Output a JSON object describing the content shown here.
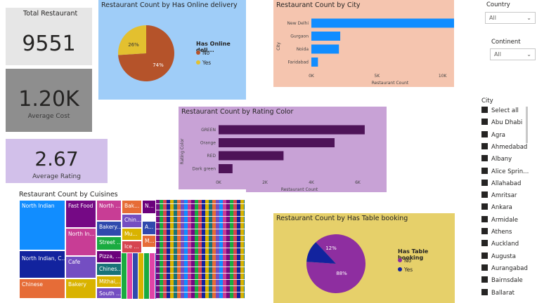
{
  "kpis": {
    "total_restaurant": {
      "label": "Total Restaurant",
      "value": "9551"
    },
    "average_cost": {
      "value": "1.20K",
      "label": "Average Cost"
    },
    "average_rating": {
      "value": "2.67",
      "label": "Average Rating"
    }
  },
  "online_delivery": {
    "title": "Restaurant Count by Has Online delivery",
    "legend_title": "Has Online deli...",
    "slices": [
      {
        "label": "No",
        "pct": "74%"
      },
      {
        "label": "Yes",
        "pct": "26%"
      }
    ]
  },
  "by_city": {
    "title": "Restaurant Count by City",
    "ylabel": "City",
    "xlabel": "Restaurant Count",
    "ticks": [
      "0K",
      "5K",
      "10K"
    ]
  },
  "rating_color": {
    "title": "Restaurant Count by Rating Color",
    "ylabel": "Rating Color",
    "xlabel": "Restaurant Count",
    "ticks": [
      "0K",
      "2K",
      "4K",
      "6K"
    ]
  },
  "cuisines": {
    "title": "Restaurant Count by Cuisines",
    "tiles": [
      "North Indian",
      "Fast Food",
      "North ...",
      "Bak...",
      "N...",
      "Chin...",
      "Bakery...",
      "A...",
      "North In...",
      "Mu...",
      "Street ...",
      "M...",
      "Ice ...",
      "North Indian, C...",
      "Cafe",
      "Chines...",
      "Pizza, ...",
      "Chinese",
      "Bakery",
      "Mithai,...",
      "South ..."
    ]
  },
  "table_booking": {
    "title": "Restaurant Count by Has Table booking",
    "legend_title": "Has Table booking",
    "slices": [
      {
        "label": "No",
        "pct": "88%"
      },
      {
        "label": "Yes",
        "pct": "12%"
      }
    ]
  },
  "filters": {
    "country": {
      "label": "Country",
      "value": "All"
    },
    "continent": {
      "label": "Continent",
      "value": "All"
    }
  },
  "city_slicer": {
    "label": "City",
    "items": [
      "Select all",
      "Abu Dhabi",
      "Agra",
      "Ahmedabad",
      "Albany",
      "Alice Sprin...",
      "Allahabad",
      "Amritsar",
      "Ankara",
      "Armidale",
      "Athens",
      "Auckland",
      "Augusta",
      "Aurangabad",
      "Bairnsdale",
      "Ballarat"
    ]
  },
  "chart_data": [
    {
      "type": "pie",
      "title": "Restaurant Count by Has Online delivery",
      "categories": [
        "No",
        "Yes"
      ],
      "values": [
        74,
        26
      ],
      "legend": "right",
      "colors": [
        "#b5532a",
        "#e3c02f"
      ]
    },
    {
      "type": "bar",
      "orientation": "horizontal",
      "title": "Restaurant Count by City",
      "categories": [
        "New Delhi",
        "Gurgaon",
        "Noida",
        "Faridabad"
      ],
      "values": [
        11000,
        2200,
        2100,
        500
      ],
      "xlabel": "Restaurant Count",
      "ylabel": "City",
      "xlim": [
        0,
        12000
      ],
      "color": "#118dff"
    },
    {
      "type": "bar",
      "orientation": "horizontal",
      "title": "Restaurant Count by Rating Color",
      "categories": [
        "GREEN",
        "Orange",
        "RED",
        "Dark green"
      ],
      "values": [
        6300,
        5000,
        2800,
        600
      ],
      "xlabel": "Restaurant Count",
      "ylabel": "Rating Color",
      "xlim": [
        0,
        7000
      ],
      "color": "#4e1358"
    },
    {
      "type": "pie",
      "title": "Restaurant Count by Has Table booking",
      "categories": [
        "No",
        "Yes"
      ],
      "values": [
        88,
        12
      ],
      "legend": "right",
      "colors": [
        "#8e2ea0",
        "#12239e"
      ]
    }
  ]
}
